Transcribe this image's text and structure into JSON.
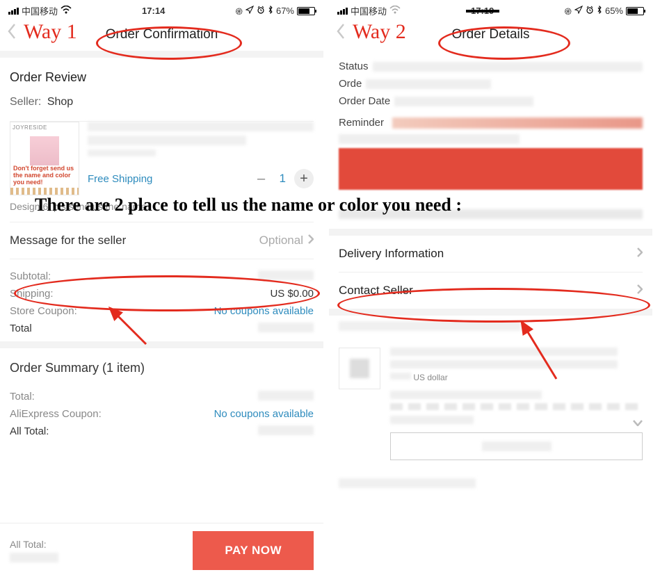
{
  "overlay_text": "There are 2 place to tell us the name or color you need :",
  "way1_label": "Way 1",
  "way2_label": "Way 2",
  "left": {
    "status": {
      "carrier": "中国移动",
      "time": "17:14",
      "battery": "67%",
      "signal": "ıııl"
    },
    "title": "Order Confirmation",
    "review_heading": "Order Review",
    "seller_label": "Seller:",
    "seller_name": "Shop",
    "thumb": {
      "brand": "JOYRESIDE",
      "note": "Don't forget send us the name and color you need!"
    },
    "free_shipping": "Free Shipping",
    "quantity": "1",
    "variant_note": "Design 6, pls send us the name",
    "msg_label": "Message for the seller",
    "msg_optional": "Optional",
    "totals": {
      "subtotal_label": "Subtotal:",
      "shipping_label": "Shipping:",
      "shipping_value": "US $0.00",
      "coupon_label": "Store Coupon:",
      "coupon_value": "No coupons available",
      "total_label": "Total"
    },
    "summary_heading": "Order Summary (1 item)",
    "summary": {
      "total_label": "Total:",
      "ali_coupon_label": "AliExpress Coupon:",
      "ali_coupon_value": "No coupons available",
      "all_total_label": "All Total:"
    },
    "paybar": {
      "all_total_label": "All Total:",
      "pay_label": "PAY NOW"
    }
  },
  "right": {
    "status": {
      "carrier": "中国移动",
      "time": "17:19",
      "battery": "65%"
    },
    "title": "Order Details",
    "fields": {
      "status_label": "Status",
      "order_label": "Orde",
      "order_date_label": "Order Date",
      "reminder_label": "Reminder"
    },
    "delivery_label": "Delivery Information",
    "contact_label": "Contact Seller",
    "usd_note": "US dollar"
  }
}
